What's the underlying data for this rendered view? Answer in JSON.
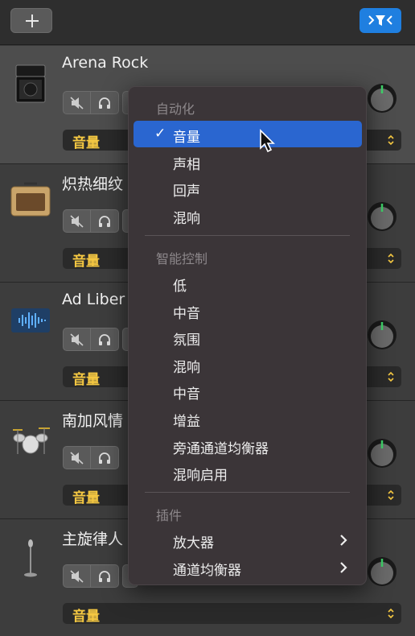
{
  "toolbar": {
    "add_label": "+",
    "add_icon": "plus-icon",
    "filter_icon": "filter-icon"
  },
  "tracks": [
    {
      "name": "Arena Rock",
      "icon": "amp-head-icon",
      "param": "音量"
    },
    {
      "name": "炽热细纹",
      "icon": "combo-amp-icon",
      "param": "音量"
    },
    {
      "name": "Ad Liber",
      "icon": "waveform-icon",
      "param": "音量"
    },
    {
      "name": "南加风情",
      "icon": "drum-kit-icon",
      "param": "音量"
    },
    {
      "name": "主旋律人",
      "icon": "microphone-icon",
      "param": "音量"
    }
  ],
  "menu": {
    "sections": [
      {
        "header": "自动化",
        "items": [
          "音量",
          "声相",
          "回声",
          "混响"
        ]
      },
      {
        "header": "智能控制",
        "items": [
          "低",
          "中音",
          "氛围",
          "混响",
          "中音",
          "增益",
          "旁通通道均衡器",
          "混响启用"
        ]
      },
      {
        "header": "插件",
        "items": [
          "放大器",
          "通道均衡器"
        ]
      }
    ],
    "checked_item": "音量",
    "check_mark": "✓"
  },
  "colors": {
    "accent": "#1f7fe0",
    "param_text": "#f5c842",
    "menu_highlight": "#2a66d0"
  }
}
